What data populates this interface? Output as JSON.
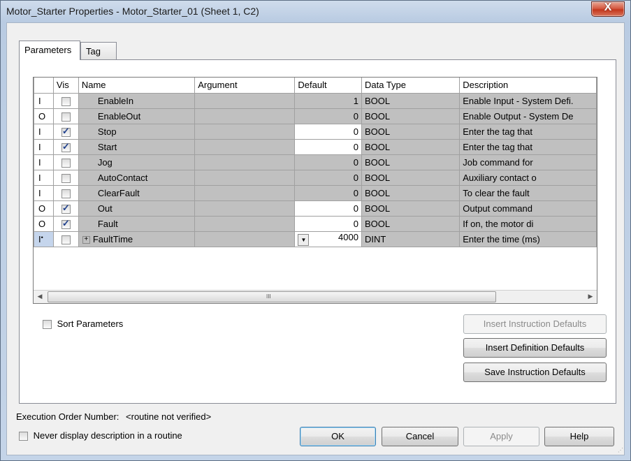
{
  "window": {
    "title": "Motor_Starter Properties - Motor_Starter_01 (Sheet 1, C2)",
    "close_label": "X"
  },
  "tabs": [
    {
      "label": "Parameters"
    },
    {
      "label": "Tag"
    }
  ],
  "grid": {
    "headers": {
      "io": "",
      "vis": "Vis",
      "name": "Name",
      "argument": "Argument",
      "default": "Default",
      "data_type": "Data Type",
      "description": "Description"
    },
    "rows": [
      {
        "io": "I",
        "vis": false,
        "name": "EnableIn",
        "argument": "",
        "default": "1",
        "data_type": "BOOL",
        "description": "Enable Input - System Defi."
      },
      {
        "io": "O",
        "vis": false,
        "name": "EnableOut",
        "argument": "",
        "default": "0",
        "data_type": "BOOL",
        "description": "Enable Output - System De"
      },
      {
        "io": "I",
        "vis": true,
        "name": "Stop",
        "argument": "",
        "default": "0",
        "data_type": "BOOL",
        "description": "Enter the tag that"
      },
      {
        "io": "I",
        "vis": true,
        "name": "Start",
        "argument": "",
        "default": "0",
        "data_type": "BOOL",
        "description": "Enter the tag that"
      },
      {
        "io": "I",
        "vis": false,
        "name": "Jog",
        "argument": "",
        "default": "0",
        "data_type": "BOOL",
        "description": "Job command for"
      },
      {
        "io": "I",
        "vis": false,
        "name": "AutoContact",
        "argument": "",
        "default": "0",
        "data_type": "BOOL",
        "description": "Auxiliary contact o"
      },
      {
        "io": "I",
        "vis": false,
        "name": "ClearFault",
        "argument": "",
        "default": "0",
        "data_type": "BOOL",
        "description": "To clear the fault"
      },
      {
        "io": "O",
        "vis": true,
        "name": "Out",
        "argument": "",
        "default": "0",
        "data_type": "BOOL",
        "description": "Output command"
      },
      {
        "io": "O",
        "vis": true,
        "name": "Fault",
        "argument": "",
        "default": "0",
        "data_type": "BOOL",
        "description": "If on, the motor di"
      },
      {
        "io": "I",
        "vis": false,
        "name": "FaultTime",
        "argument": "",
        "default": "4000",
        "data_type": "DINT",
        "description": "Enter the time (ms)"
      }
    ],
    "scroll_grip": "III"
  },
  "sort_parameters": {
    "label": "Sort Parameters",
    "checked": false
  },
  "buttons": {
    "insert_instruction_defaults": "Insert Instruction Defaults",
    "insert_definition_defaults": "Insert Definition Defaults",
    "save_instruction_defaults": "Save Instruction Defaults",
    "ok": "OK",
    "cancel": "Cancel",
    "apply": "Apply",
    "help": "Help"
  },
  "execution_order": {
    "label": "Execution Order Number:",
    "value": "<routine not verified>"
  },
  "never_display": {
    "label": "Never display description in a routine",
    "checked": false
  }
}
